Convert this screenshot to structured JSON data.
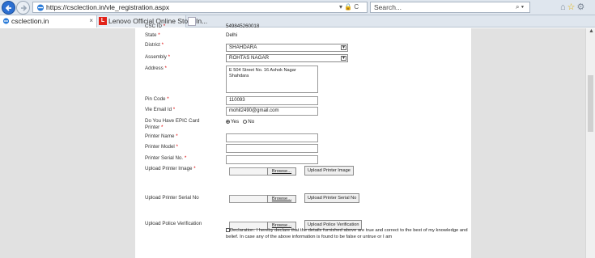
{
  "browser": {
    "url": "https://csclection.in/vle_registration.aspx",
    "addr_tools": "▾ 🔒 C",
    "search_placeholder": "Search...",
    "tabs": [
      {
        "label": "csclection.in",
        "close": "×"
      },
      {
        "label": "Lenovo Official Online Store In...",
        "icon": "L"
      }
    ]
  },
  "form": {
    "csc_id": {
      "label": "CSC ID",
      "req": "*",
      "value": "549845260018"
    },
    "state": {
      "label": "State",
      "req": "*",
      "value": "Delhi"
    },
    "district": {
      "label": "District",
      "req": "*",
      "value": "SHAHDARA"
    },
    "assembly": {
      "label": "Assembly",
      "req": "*",
      "value": "ROHTAS NAGAR"
    },
    "address": {
      "label": "Address",
      "req": "*",
      "line1": "E 504 Street No. 16 Ashok Nagar",
      "line2": "Shahdara"
    },
    "pin_code": {
      "label": "Pin Code",
      "req": "*",
      "value": "110093"
    },
    "vle_email": {
      "label": "Vle Email Id",
      "req": "*",
      "value": "mohit2490@gmail.com"
    },
    "epic_printer": {
      "label_line1": "Do You Have EPIC Card",
      "label_line2": "Printer",
      "req": "*",
      "yes": "Yes",
      "no": "No"
    },
    "printer_name": {
      "label": "Printer Name",
      "req": "*"
    },
    "printer_model": {
      "label": "Printer Model",
      "req": "*"
    },
    "printer_serial": {
      "label": "Printer Serial No.",
      "req": "*"
    },
    "upload_printer_image": {
      "label": "Upload Printer Image",
      "req": "*",
      "browse": "Browse...",
      "button": "Upload Printer Image"
    },
    "upload_printer_serial": {
      "label": "Upload Printer Serial No",
      "browse": "Browse...",
      "button": "Upload Printer Serial No"
    },
    "upload_police": {
      "label": "Upload Police Verification",
      "browse": "Browse...",
      "button": "Upload Police Verification"
    },
    "declaration": "Declaration: I hereby declare that the details furnished above are true and correct to the best of my knowledge and belief. In case any of the above information is found to be false or untrue or I am"
  }
}
